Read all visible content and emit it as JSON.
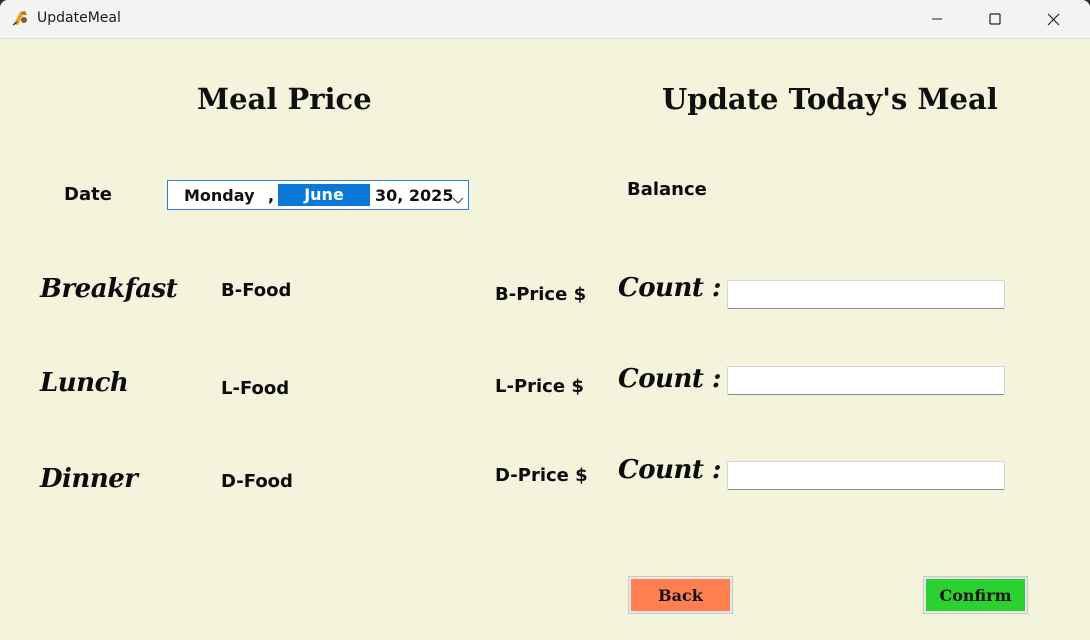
{
  "window": {
    "title": "UpdateMeal"
  },
  "headings": {
    "meal_price": "Meal Price",
    "update_meal": "Update Today's Meal"
  },
  "date": {
    "label": "Date",
    "day": "Monday",
    "separator": ",",
    "month": "June",
    "rest": "30, 2025"
  },
  "balance": {
    "label": "Balance"
  },
  "meals": [
    {
      "name": "Breakfast",
      "food": "B-Food",
      "price": "B-Price $",
      "count_label": "Count :",
      "count_value": ""
    },
    {
      "name": "Lunch",
      "food": "L-Food",
      "price": "L-Price $",
      "count_label": "Count :",
      "count_value": ""
    },
    {
      "name": "Dinner",
      "food": "D-Food",
      "price": "D-Price $",
      "count_label": "Count :",
      "count_value": ""
    }
  ],
  "buttons": {
    "back": "Back",
    "confirm": "Confirm"
  },
  "colors": {
    "background": "#f4f3dc",
    "back_button": "#ff7f50",
    "confirm_button": "#2bd12f",
    "date_highlight": "#0a78d7"
  },
  "icons": {
    "app": "app-icon",
    "minimize": "minimize-icon",
    "maximize": "maximize-icon",
    "close": "close-icon",
    "date_dropdown": "chevron-down-icon"
  }
}
